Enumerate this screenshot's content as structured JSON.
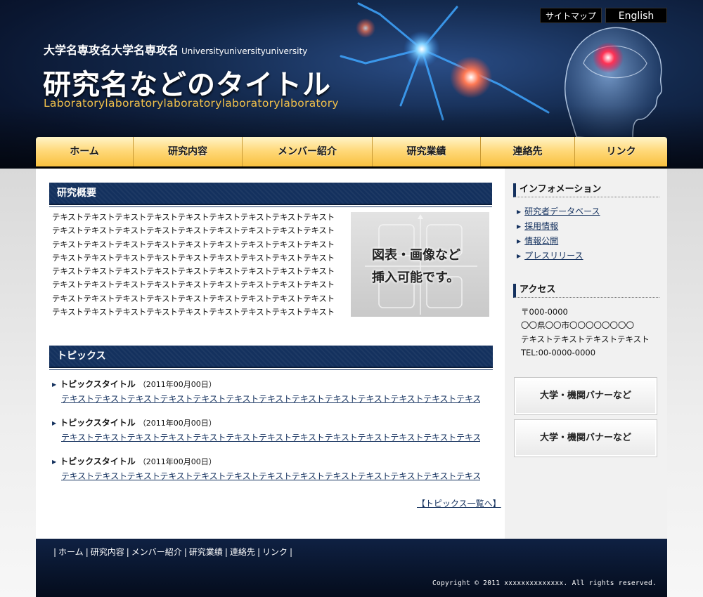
{
  "header": {
    "university": "大学名専攻名大学名専攻名",
    "university_en": "Universityuniversityuniversity",
    "title": "研究名などのタイトル",
    "lab": "Laboratorylaboratorylaboratorylaboratorylaboratory",
    "util_nav": {
      "sitemap": "サイトマップ",
      "english": "English"
    }
  },
  "gnav": [
    {
      "label": "ホーム"
    },
    {
      "label": "研究内容"
    },
    {
      "label": "メンバー紹介"
    },
    {
      "label": "研究業績"
    },
    {
      "label": "連絡先"
    },
    {
      "label": "リンク"
    }
  ],
  "overview": {
    "heading": "研究概要",
    "lines": [
      "テキストテキストテキストテキストテキストテキストテキストテキストテキスト",
      "テキストテキストテキストテキストテキストテキストテキストテキストテキスト",
      "テキストテキストテキストテキストテキストテキストテキストテキストテキスト",
      "テキストテキストテキストテキストテキストテキストテキストテキストテキスト",
      "テキストテキストテキストテキストテキストテキストテキストテキストテキスト",
      "テキストテキストテキストテキストテキストテキストテキストテキストテキスト",
      "テキストテキストテキストテキストテキストテキストテキストテキストテキスト",
      "テキストテキストテキストテキストテキストテキストテキストテキストテキスト"
    ],
    "figure_line1": "図表・画像など",
    "figure_line2": "挿入可能です。"
  },
  "topics": {
    "heading": "トピックス",
    "items": [
      {
        "title": "トピックスタイトル",
        "date": "（2011年00月00日）",
        "text": "テキストテキストテキストテキストテキストテキストテキストテキストテキストテキストテキストテキストテキストテキストテキ"
      },
      {
        "title": "トピックスタイトル",
        "date": "（2011年00月00日）",
        "text": "テキストテキストテキストテキストテキストテキストテキストテキストテキストテキストテキストテキストテキストテキストテキ"
      },
      {
        "title": "トピックスタイトル",
        "date": "（2011年00月00日）",
        "text": "テキストテキストテキストテキストテキストテキストテキストテキストテキストテキストテキストテキストテキストテキストテキ"
      }
    ],
    "more_link": "【トピックス一覧へ】"
  },
  "sidebar": {
    "info_heading": "インフォメーション",
    "info_links": [
      "研究者データベース",
      "採用情報",
      "情報公開",
      "プレスリリース"
    ],
    "access_heading": "アクセス",
    "access_lines": [
      "〒000-0000",
      "〇〇県〇〇市〇〇〇〇〇〇〇〇",
      "テキストテキストテキストテキスト",
      "TEL:00-0000-0000"
    ],
    "banners": [
      "大学・機関バナーなど",
      "大学・機関バナーなど"
    ]
  },
  "footer": {
    "nav": [
      "ホーム",
      "研究内容",
      "メンバー紹介",
      "研究業績",
      "連絡先",
      "リンク"
    ],
    "copyright": "Copyright © 2011 xxxxxxxxxxxxxx. All rights reserved."
  }
}
